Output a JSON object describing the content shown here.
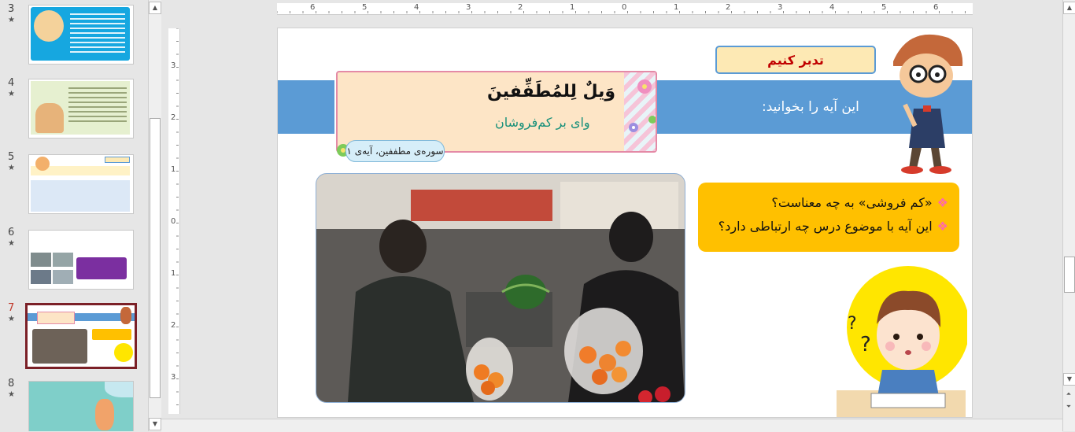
{
  "thumbnails": [
    {
      "number": "3",
      "star": "★"
    },
    {
      "number": "4",
      "star": "★"
    },
    {
      "number": "5",
      "star": "★"
    },
    {
      "number": "6",
      "star": "★"
    },
    {
      "number": "7",
      "star": "★",
      "active": true
    },
    {
      "number": "8",
      "star": "★"
    }
  ],
  "ruler": {
    "h_labels": [
      "6",
      "5",
      "4",
      "3",
      "2",
      "1",
      "0",
      "1",
      "2",
      "3",
      "4",
      "5",
      "6"
    ],
    "v_labels": [
      "3",
      "2",
      "1",
      "0",
      "1",
      "2",
      "3"
    ]
  },
  "slide": {
    "reflect_label": "تدبر کنیم",
    "instruction": "این آیه را بخوانید:",
    "verse_arabic": "وَيلٌ لِلمُطَفِّفينَ",
    "verse_persian": "وای بر کم‌فروشان",
    "verse_reference": "سوره‌ی مطففین، آیه‌ی ۱",
    "questions": [
      "«کم فروشی» به چه معناست؟",
      "این آیه با موضوع درس چه ارتباطی دارد؟"
    ],
    "question_bullet": "❖"
  },
  "scrollbar": {
    "up": "▲",
    "down": "▼",
    "prev_slide": "⏶",
    "next_slide": "⏷"
  },
  "colors": {
    "band": "#5b9bd5",
    "reflect_text": "#c00000",
    "question_bg": "#ffc000",
    "verse_persian": "#17907a",
    "active_thumb_border": "#7b2027"
  }
}
